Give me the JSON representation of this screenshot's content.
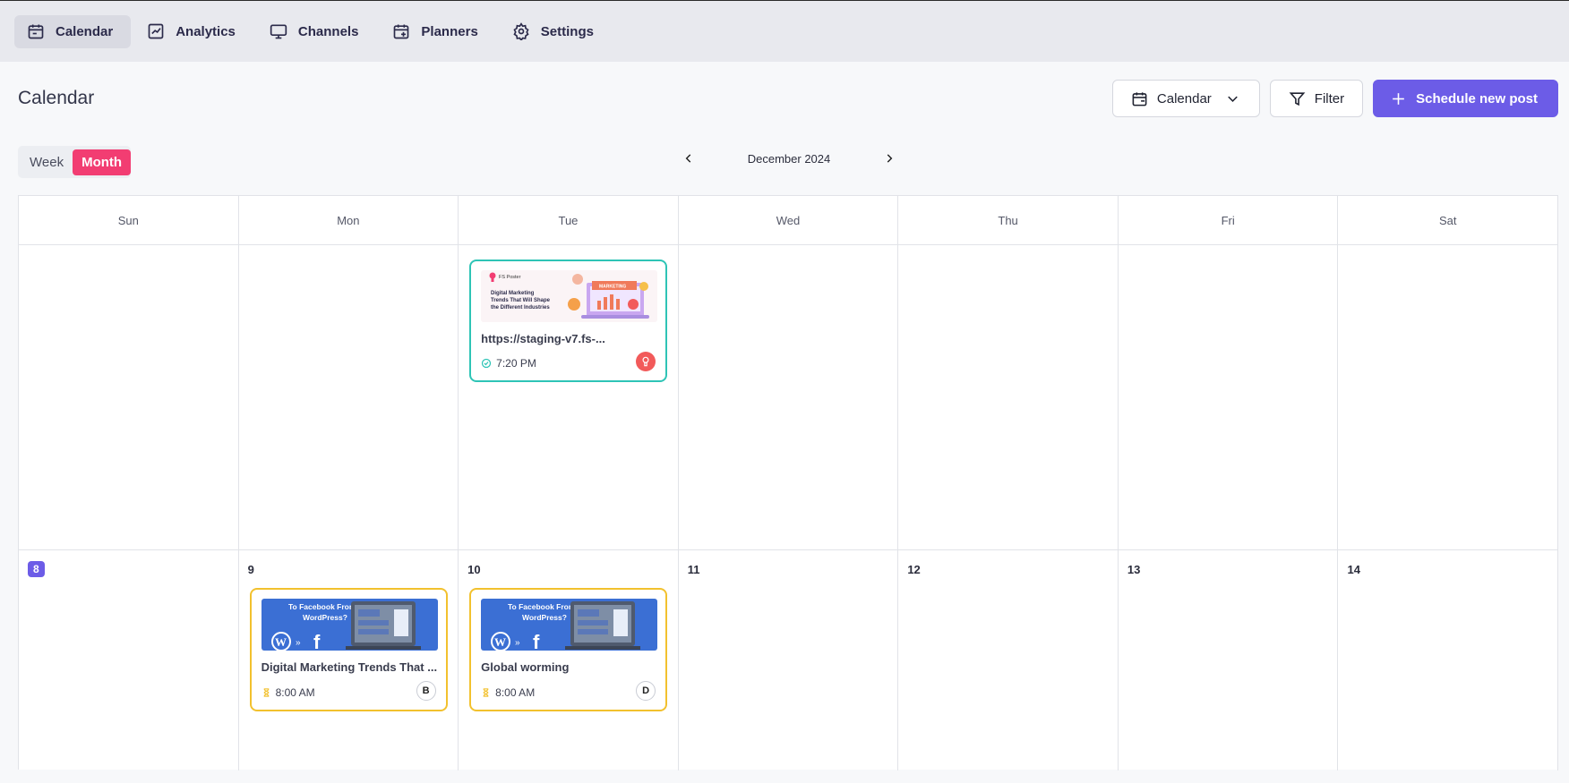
{
  "nav": {
    "items": [
      {
        "label": "Calendar",
        "icon": "calendar-icon",
        "active": true
      },
      {
        "label": "Analytics",
        "icon": "analytics-icon"
      },
      {
        "label": "Channels",
        "icon": "monitor-icon"
      },
      {
        "label": "Planners",
        "icon": "calendar-plus-icon"
      },
      {
        "label": "Settings",
        "icon": "gear-icon"
      }
    ]
  },
  "header": {
    "title": "Calendar",
    "view_select_label": "Calendar",
    "filter_label": "Filter",
    "schedule_label": "Schedule new post"
  },
  "view_toggle": {
    "week": "Week",
    "month": "Month",
    "selected": "Month"
  },
  "month_nav": {
    "label": "December 2024"
  },
  "days_of_week": [
    "Sun",
    "Mon",
    "Tue",
    "Wed",
    "Thu",
    "Fri",
    "Sat"
  ],
  "week2": {
    "days": [
      "8",
      "9",
      "10",
      "11",
      "12",
      "13",
      "14"
    ],
    "today": "8"
  },
  "posts": {
    "tue_week1": {
      "title": "https://staging-v7.fs-...",
      "time": "7:20 PM",
      "status": "published",
      "thumb_brand": "FS Poster",
      "thumb_line1": "Digital Marketing",
      "thumb_line2": "Trends That Will Shape",
      "thumb_line3": "the Different Industries",
      "thumb_banner": "MARKETING",
      "border_color": "#2ec4b6"
    },
    "mon_9": {
      "title": "Digital Marketing Trends That ...",
      "time": "8:00 AM",
      "avatar": "B",
      "thumb_line1": "To Facebook From",
      "thumb_line2": "WordPress?",
      "border_color": "#f2c12e"
    },
    "tue_10": {
      "title": "Global worming",
      "time": "8:00 AM",
      "avatar": "D",
      "thumb_line1": "To Facebook From",
      "thumb_line2": "WordPress?",
      "border_color": "#f2c12e"
    }
  },
  "colors": {
    "primary": "#6c5ce7",
    "month_active": "#f23d72",
    "today": "#6c5ce7"
  }
}
